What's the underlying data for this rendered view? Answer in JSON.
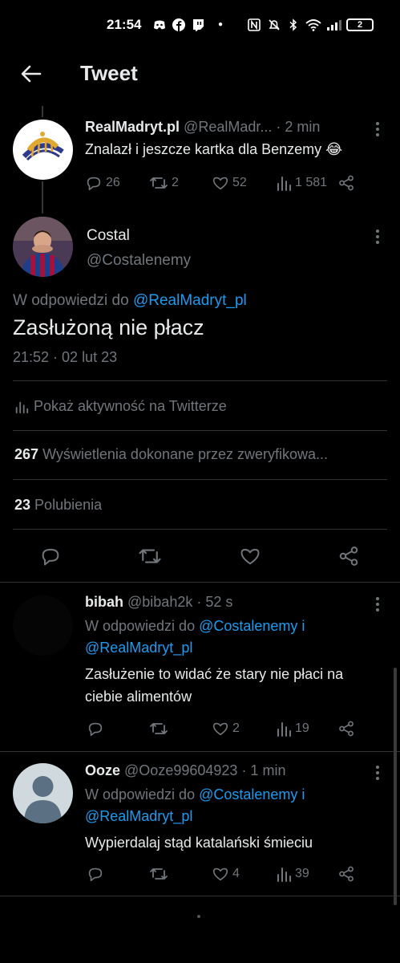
{
  "status_bar": {
    "time": "21:54",
    "battery": "2"
  },
  "header": {
    "title": "Tweet"
  },
  "parent_tweet": {
    "name": "RealMadryt.pl",
    "handle": "@RealMadr...",
    "time": "· 2 min",
    "text": "Znalazł i jeszcze kartka dla Benzemy 😂",
    "replies": "26",
    "retweets": "2",
    "likes": "52",
    "views": "1 581"
  },
  "main_tweet": {
    "name": "Costal",
    "handle": "@Costalenemy",
    "reply_prefix": "W odpowiedzi do",
    "reply_to": "@RealMadryt_pl",
    "text": "Zasłużoną nie płacz",
    "timestamp": "21:52 · 02 lut 23",
    "activity_label": "Pokaż aktywność na Twitterze",
    "views_count": "267",
    "views_label": "Wyświetlenia dokonane przez zweryfikowa...",
    "likes_count": "23",
    "likes_label": "Polubienia"
  },
  "replies": [
    {
      "name": "bibah",
      "handle": "@bibah2k",
      "time": "· 52 s",
      "reply_prefix": "W odpowiedzi do",
      "reply_to_1": "@Costalenemy i",
      "reply_to_2": "@RealMadryt_pl",
      "text_1": "Zasłużenie to widać że stary nie płaci na",
      "text_2": "ciebie alimentów",
      "likes": "2",
      "views": "19"
    },
    {
      "name": "Ooze",
      "handle": "@Ooze99604923",
      "time": "· 1 min",
      "reply_prefix": "W odpowiedzi do",
      "reply_to_1": "@Costalenemy i",
      "reply_to_2": "@RealMadryt_pl",
      "text_1": "Wypierdalaj stąd katalański śmieciu",
      "likes": "4",
      "views": "39"
    }
  ],
  "colors": {
    "background": "#000000",
    "text": "#e7e9ea",
    "muted": "#71767b",
    "accent": "#1d9bf0"
  }
}
